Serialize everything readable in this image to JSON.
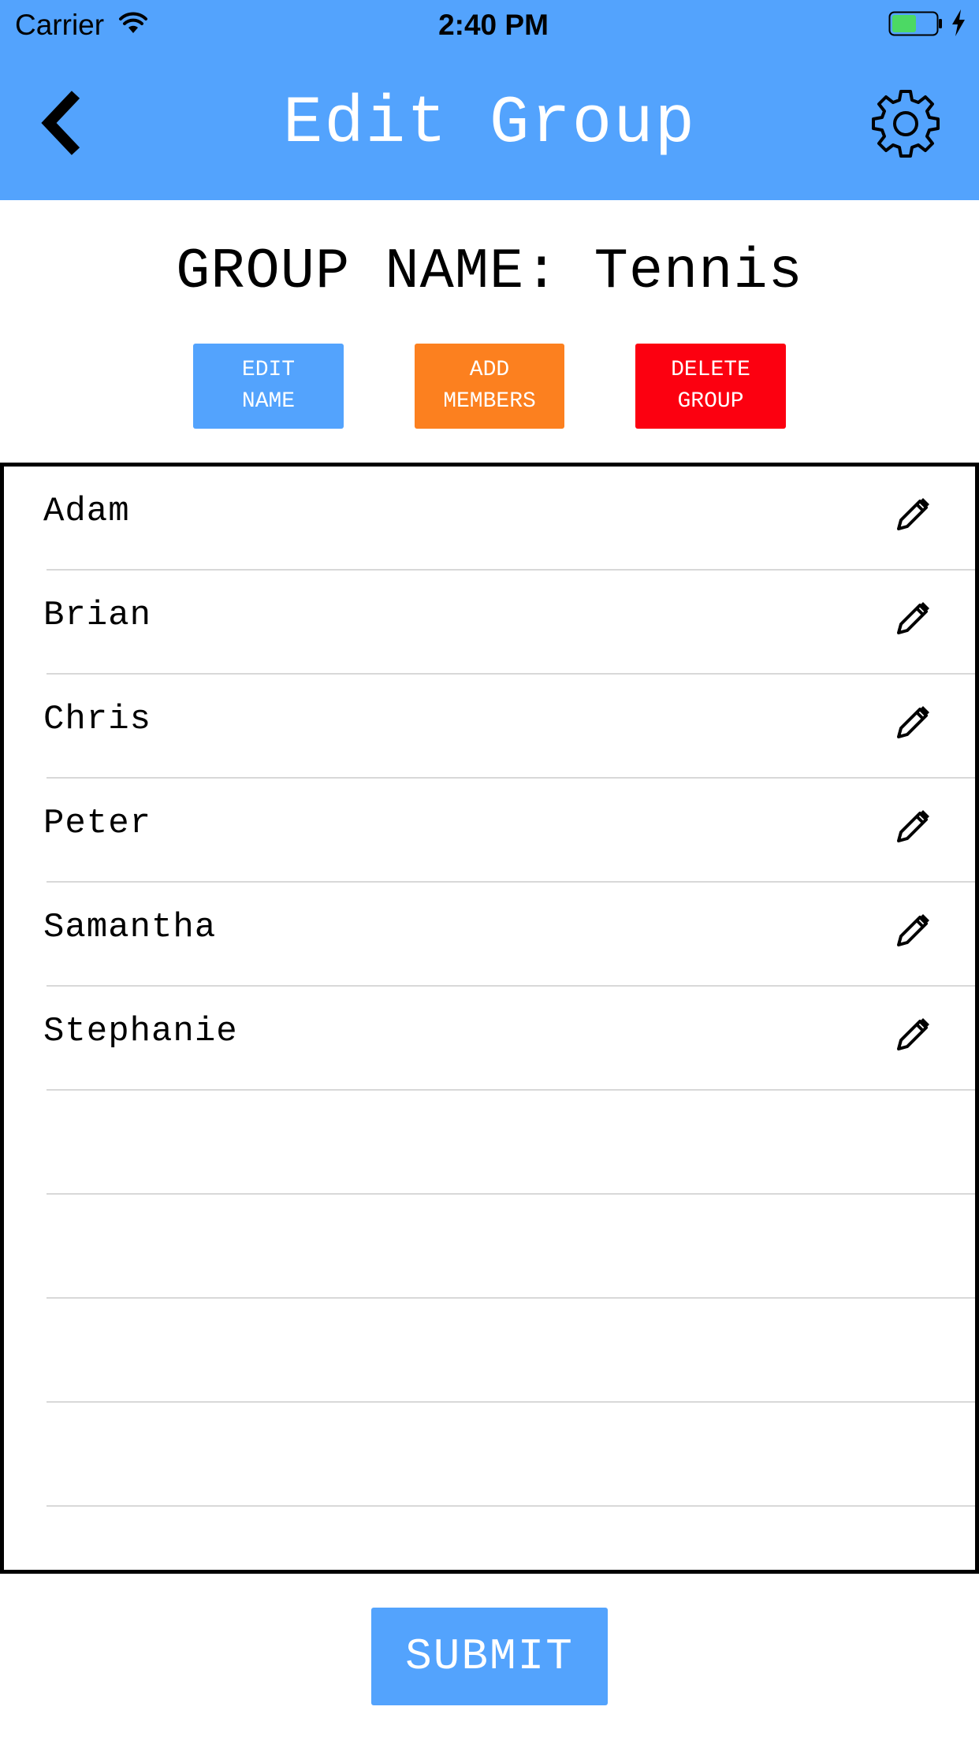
{
  "status_bar": {
    "carrier": "Carrier",
    "time": "2:40 PM",
    "wifi_icon": "wifi-icon",
    "battery_icon": "battery-charging-icon",
    "battery_color": "#4cd964"
  },
  "nav": {
    "title": "Edit Group",
    "back_icon": "chevron-left-icon",
    "settings_icon": "gear-icon",
    "background_color": "#53a3fd"
  },
  "group": {
    "title": "GROUP NAME: Tennis"
  },
  "actions": {
    "edit_name": "EDIT\nNAME",
    "add_members": "ADD\nMEMBERS",
    "delete_group": "DELETE\nGROUP",
    "edit_color": "#53a3fd",
    "add_color": "#fc801f",
    "delete_color": "#fc0010"
  },
  "members": [
    {
      "name": "Adam",
      "icon": "pencil-icon"
    },
    {
      "name": "Brian",
      "icon": "pencil-icon"
    },
    {
      "name": "Chris",
      "icon": "pencil-icon"
    },
    {
      "name": "Peter",
      "icon": "pencil-icon"
    },
    {
      "name": "Samantha",
      "icon": "pencil-icon"
    },
    {
      "name": "Stephanie",
      "icon": "pencil-icon"
    },
    {
      "name": ""
    },
    {
      "name": ""
    },
    {
      "name": ""
    },
    {
      "name": ""
    }
  ],
  "footer": {
    "submit": "SUBMIT"
  }
}
